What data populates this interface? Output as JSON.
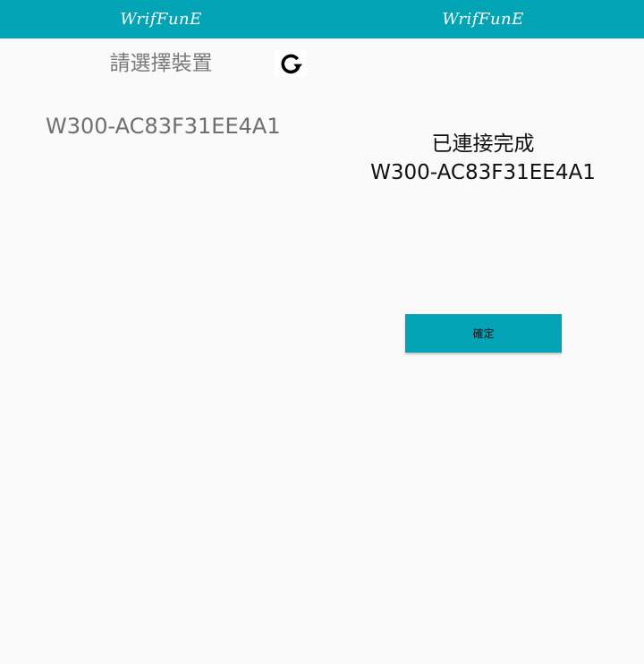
{
  "colors": {
    "accent": "#00a4b4",
    "background": "#fafafa",
    "text_primary": "#111111",
    "text_secondary": "#6f6f6f"
  },
  "device_select_screen": {
    "app_title": "WrifFunE",
    "title": "請選擇裝置",
    "refresh_icon": "refresh-icon",
    "devices": [
      "W300-AC83F31EE4A1"
    ]
  },
  "connected_screen": {
    "app_title": "WrifFunE",
    "status": "已連接完成",
    "device": "W300-AC83F31EE4A1",
    "confirm_label": "確定"
  }
}
